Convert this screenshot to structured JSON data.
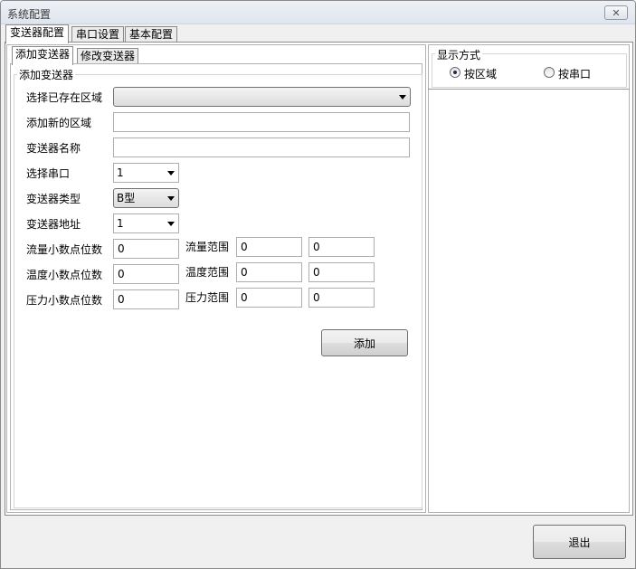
{
  "window": {
    "title": "系统配置",
    "close_symbol": "✕"
  },
  "top_tabs": [
    "变送器配置",
    "串口设置",
    "基本配置"
  ],
  "inner_tabs": [
    "添加变送器",
    "修改变送器"
  ],
  "add_group": {
    "title": "添加变送器",
    "select_area_label": "选择已存在区域",
    "select_area_value": "",
    "new_area_label": "添加新的区域",
    "new_area_value": "",
    "name_label": "变送器名称",
    "name_value": "",
    "port_label": "选择串口",
    "port_value": "1",
    "type_label": "变送器类型",
    "type_value": "B型",
    "address_label": "变送器地址",
    "address_value": "1",
    "flow_decimals_label": "流量小数点位数",
    "flow_decimals_value": "0",
    "flow_range_label": "流量范围",
    "flow_range_min": "0",
    "flow_range_max": "0",
    "temp_decimals_label": "温度小数点位数",
    "temp_decimals_value": "0",
    "temp_range_label": "温度范围",
    "temp_range_min": "0",
    "temp_range_max": "0",
    "pressure_decimals_label": "压力小数点位数",
    "pressure_decimals_value": "0",
    "pressure_range_label": "压力范围",
    "pressure_range_min": "0",
    "pressure_range_max": "0",
    "add_button": "添加"
  },
  "display_mode": {
    "title": "显示方式",
    "option_area": "按区域",
    "option_port": "按串口",
    "selected": "按区域"
  },
  "exit_button": "退出",
  "icons": {
    "close": "close-icon",
    "dropdown": "chevron-down-icon",
    "radio_on": "radio-selected-icon",
    "radio_off": "radio-unselected-icon"
  },
  "colors": {
    "border": "#8c8c8c",
    "window_bg": "#f0f0f0",
    "radio_dot": "#1d2c4a"
  }
}
